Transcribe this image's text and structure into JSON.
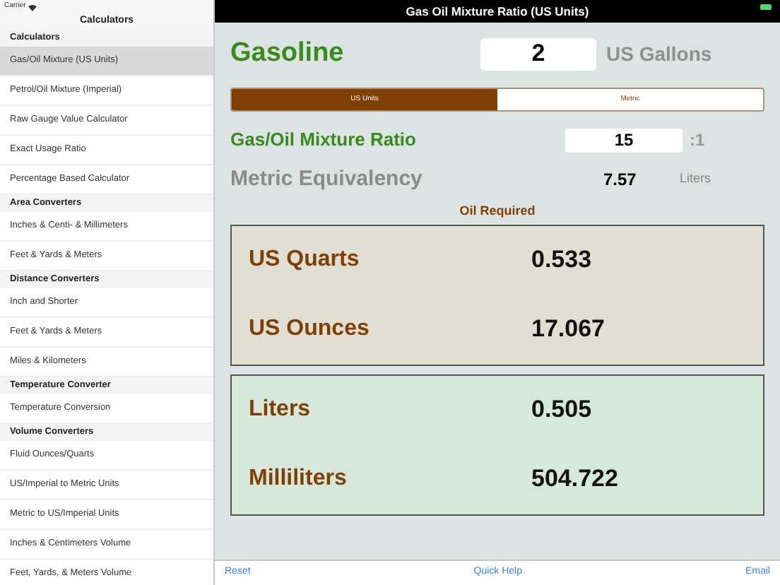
{
  "status_bar": {
    "carrier": "Carrier"
  },
  "sidebar": {
    "title": "Calculators",
    "sections": [
      {
        "title": "Calculators",
        "items": [
          {
            "label": "Gas/Oil Mixture (US Units)",
            "selected": true
          },
          {
            "label": "Petrol/Oil Mixture (Imperial)",
            "selected": false
          },
          {
            "label": "Raw Gauge Value Calculator",
            "selected": false
          },
          {
            "label": "Exact Usage Ratio",
            "selected": false
          },
          {
            "label": "Percentage Based Calculator",
            "selected": false
          }
        ]
      },
      {
        "title": "Area Converters",
        "items": [
          {
            "label": "Inches & Centi- & Millimeters",
            "selected": false
          },
          {
            "label": "Feet & Yards & Meters",
            "selected": false
          }
        ]
      },
      {
        "title": "Distance Converters",
        "items": [
          {
            "label": "Inch and Shorter",
            "selected": false
          },
          {
            "label": "Feet & Yards & Meters",
            "selected": false
          },
          {
            "label": "Miles & Kilometers",
            "selected": false
          }
        ]
      },
      {
        "title": "Temperature Converter",
        "items": [
          {
            "label": "Temperature Conversion",
            "selected": false
          }
        ]
      },
      {
        "title": "Volume Converters",
        "items": [
          {
            "label": "Fluid Ounces/Quarts",
            "selected": false
          },
          {
            "label": "US/Imperial to Metric Units",
            "selected": false
          },
          {
            "label": "Metric to US/Imperial Units",
            "selected": false
          },
          {
            "label": "Inches & Centimeters Volume",
            "selected": false
          },
          {
            "label": "Feet, Yards, & Meters Volume",
            "selected": false
          }
        ]
      }
    ]
  },
  "window": {
    "title": "Gas Oil Mixture Ratio (US Units)"
  },
  "gasoline": {
    "label": "Gasoline",
    "value": "2",
    "unit": "US Gallons"
  },
  "unit_tabs": [
    {
      "label": "US Units",
      "selected": true
    },
    {
      "label": "Metric",
      "selected": false
    }
  ],
  "ratio": {
    "label": "Gas/Oil Mixture Ratio",
    "value": "15",
    "suffix": ":1"
  },
  "metric": {
    "label": "Metric Equivalency",
    "value": "7.57",
    "unit": "Liters"
  },
  "oil_required": {
    "title": "Oil Required",
    "groups": [
      {
        "kind": "us",
        "rows": [
          {
            "label": "US Quarts",
            "value": "0.533"
          },
          {
            "label": "US Ounces",
            "value": "17.067"
          }
        ]
      },
      {
        "kind": "metric",
        "rows": [
          {
            "label": "Liters",
            "value": "0.505"
          },
          {
            "label": "Milliliters",
            "value": "504.722"
          }
        ]
      }
    ]
  },
  "toolbar": [
    "Reset",
    "Quick Help",
    "Email"
  ]
}
